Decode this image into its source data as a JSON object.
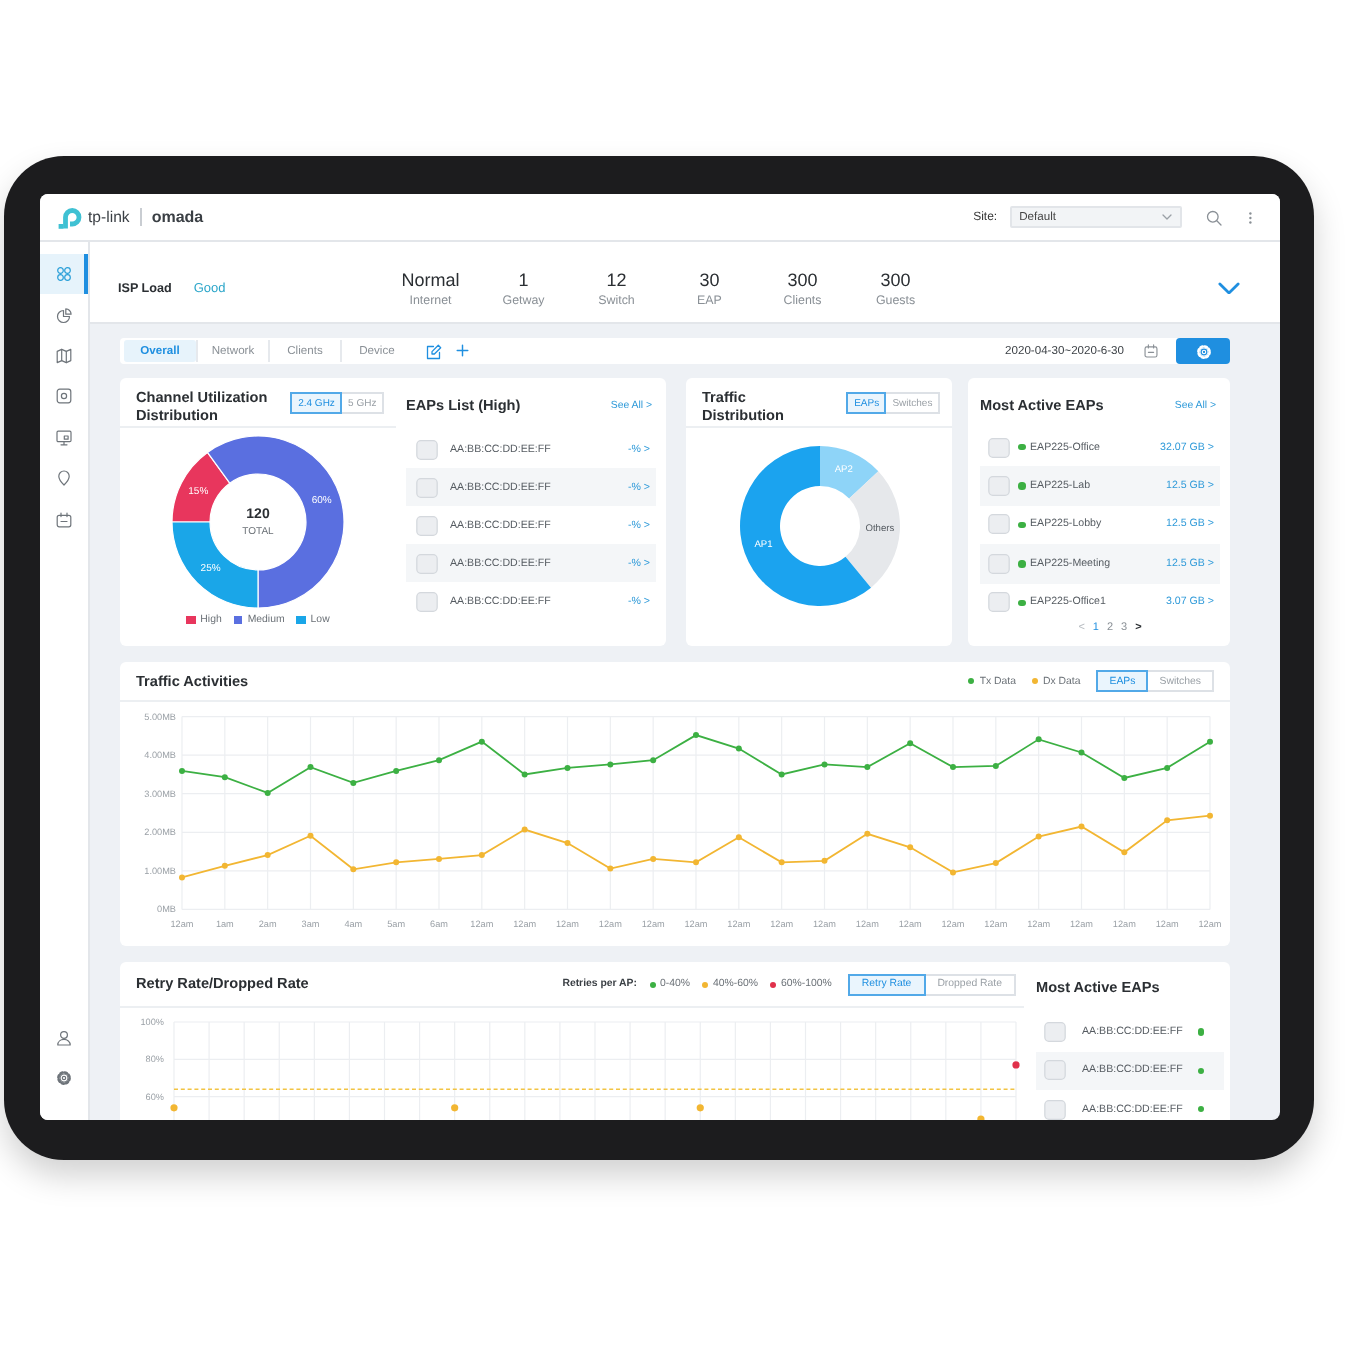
{
  "header": {
    "brand": "tp-link",
    "product": "omada",
    "site_label": "Site:",
    "site_value": "Default"
  },
  "sidebar": {
    "items": [
      {
        "selected": true
      },
      {
        "selected": false
      },
      {
        "selected": false
      },
      {
        "selected": false
      },
      {
        "selected": false
      },
      {
        "selected": false
      },
      {
        "selected": false
      }
    ],
    "bottom_items": [
      {
        "selected": false
      },
      {
        "selected": false
      }
    ]
  },
  "isp": {
    "label": "ISP Load",
    "status": "Good",
    "stats": [
      {
        "value": "Normal",
        "label": "Internet"
      },
      {
        "value": "1",
        "label": "Getway"
      },
      {
        "value": "12",
        "label": "Switch"
      },
      {
        "value": "30",
        "label": "EAP"
      },
      {
        "value": "300",
        "label": "Clients"
      },
      {
        "value": "300",
        "label": "Guests"
      }
    ]
  },
  "toolbar": {
    "tabs": [
      {
        "label": "Overall",
        "selected": true
      },
      {
        "label": "Network",
        "selected": false
      },
      {
        "label": "Clients",
        "selected": false
      },
      {
        "label": "Device",
        "selected": false
      }
    ],
    "date_range": "2020-04-30~2020-6-30"
  },
  "channel_utilization": {
    "title": "Channel Utilization Distribution",
    "bands": [
      {
        "label": "2.4 GHz",
        "selected": true
      },
      {
        "label": "5 GHz",
        "selected": false
      }
    ],
    "total": "120",
    "total_label": "TOTAL",
    "chart_data": {
      "type": "donut",
      "categories": [
        "High",
        "Medium",
        "Low"
      ],
      "values": [
        15,
        60,
        25
      ],
      "value_labels": [
        "15%",
        "60%",
        "25%"
      ]
    },
    "legend": [
      {
        "color": "#e8365d"
      },
      {
        "color": "#5a6fe0"
      },
      {
        "color": "#1aa6e8"
      }
    ]
  },
  "eaps_list": {
    "title": "EAPs List (High)",
    "see_all": "See All >",
    "rows": [
      {
        "mac": "AA:BB:CC:DD:EE:FF",
        "value": "-% >"
      },
      {
        "mac": "AA:BB:CC:DD:EE:FF",
        "value": "-% >"
      },
      {
        "mac": "AA:BB:CC:DD:EE:FF",
        "value": "-% >"
      },
      {
        "mac": "AA:BB:CC:DD:EE:FF",
        "value": "-% >"
      },
      {
        "mac": "AA:BB:CC:DD:EE:FF",
        "value": "-% >"
      }
    ]
  },
  "traffic_distribution": {
    "title": "Traffic Distribution",
    "filters": [
      {
        "label": "EAPs",
        "selected": true
      },
      {
        "label": "Switches",
        "selected": false
      }
    ],
    "slices": [
      {
        "label": "AP2",
        "color": "#8ed4f8"
      },
      {
        "label": "Others",
        "color": "#e6e8eb"
      },
      {
        "label": "AP1",
        "color": "#1ba3ef"
      }
    ]
  },
  "most_active": {
    "title": "Most Active EAPs",
    "see_all": "See All >",
    "rows": [
      {
        "name": "EAP225-Office",
        "value": "32.07 GB >",
        "online": true
      },
      {
        "name": "EAP225-Lab",
        "value": "12.5 GB >",
        "online": true
      },
      {
        "name": "EAP225-Lobby",
        "value": "12.5 GB >",
        "online": true
      },
      {
        "name": "EAP225-Meeting",
        "value": "12.5 GB >",
        "online": true
      },
      {
        "name": "EAP225-Office1",
        "value": "3.07 GB >",
        "online": true
      }
    ],
    "pagination": {
      "prev": {
        "label": "<",
        "disabled": true
      },
      "pages": [
        {
          "label": "1",
          "selected": true
        },
        {
          "label": "2",
          "selected": false
        },
        {
          "label": "3",
          "selected": false
        }
      ],
      "next": {
        "label": ">",
        "disabled": false
      }
    }
  },
  "traffic_activities": {
    "title": "Traffic Activities",
    "filters": [
      {
        "label": "EAPs",
        "selected": true
      },
      {
        "label": "Switches",
        "selected": false
      }
    ],
    "chart_data": {
      "type": "line",
      "grid": true,
      "categories": [
        "12am",
        "1am",
        "2am",
        "3am",
        "4am",
        "5am",
        "6am",
        "12am",
        "12am",
        "12am",
        "12am",
        "12am",
        "12am",
        "12am",
        "12am",
        "12am",
        "12am",
        "12am",
        "12am",
        "12am",
        "12am",
        "12am",
        "12am",
        "12am",
        "12am"
      ],
      "ylim": [
        0,
        5
      ],
      "yticks": [
        {
          "value": 0,
          "label": "0MB"
        },
        {
          "value": 1,
          "label": "1.00MB"
        },
        {
          "value": 2,
          "label": "2.00MB"
        },
        {
          "value": 3,
          "label": "3.00MB"
        },
        {
          "value": 4,
          "label": "4.00MB"
        },
        {
          "value": 5,
          "label": "5.00MB"
        }
      ],
      "series": [
        {
          "name": "Tx Data",
          "color": "#3cb043",
          "marker": "circle",
          "values": [
            3.59,
            3.43,
            3.02,
            3.69,
            3.28,
            3.59,
            3.87,
            4.35,
            3.5,
            3.67,
            3.76,
            3.87,
            4.52,
            4.17,
            3.5,
            3.76,
            3.69,
            4.31,
            3.69,
            3.72,
            4.41,
            4.07,
            3.41,
            3.67,
            4.35
          ]
        },
        {
          "name": "Dx Data",
          "color": "#f2b632",
          "marker": "circle",
          "values": [
            0.83,
            1.13,
            1.41,
            1.91,
            1.04,
            1.22,
            1.31,
            1.41,
            2.07,
            1.72,
            1.06,
            1.31,
            1.22,
            1.87,
            1.22,
            1.26,
            1.96,
            1.61,
            0.96,
            1.2,
            1.89,
            2.15,
            1.48,
            2.31,
            2.43
          ]
        }
      ]
    }
  },
  "retry": {
    "title": "Retry Rate/Dropped Rate",
    "legend_title": "Retries per AP:",
    "legend": [
      {
        "label": "0-40%",
        "color": "#3cb043"
      },
      {
        "label": "40%-60%",
        "color": "#f2b632"
      },
      {
        "label": "60%-100%",
        "color": "#e0314b"
      }
    ],
    "modes": [
      {
        "label": "Retry Rate",
        "selected": true
      },
      {
        "label": "Dropped Rate",
        "selected": false
      }
    ],
    "y_labels": [
      "100%",
      "80%",
      "60%"
    ],
    "side_title": "Most Active EAPs",
    "rows": [
      {
        "mac": "AA:BB:CC:DD:EE:FF",
        "online": true
      },
      {
        "mac": "AA:BB:CC:DD:EE:FF",
        "online": true
      },
      {
        "mac": "AA:BB:CC:DD:EE:FF",
        "online": true
      }
    ]
  }
}
